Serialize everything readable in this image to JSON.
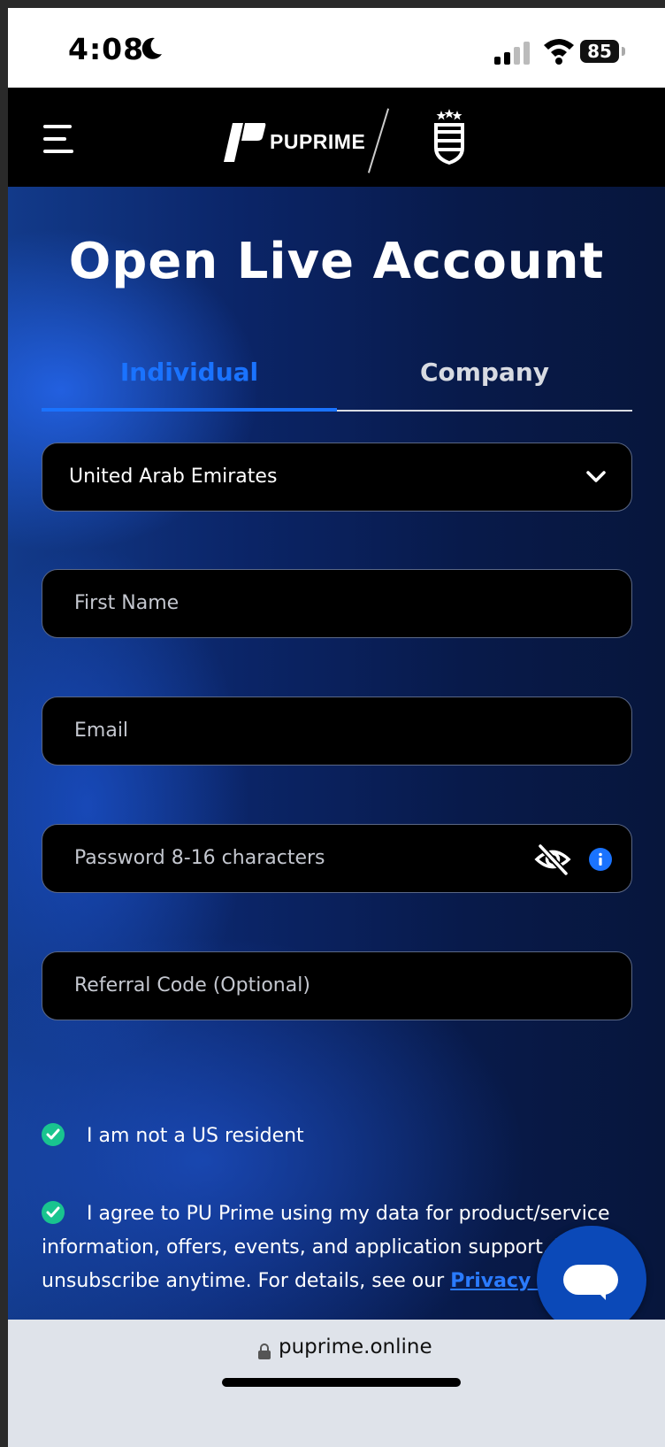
{
  "status_bar": {
    "time": "4:08",
    "battery": "85"
  },
  "header": {
    "brand": "PUPRIME"
  },
  "page": {
    "title": "Open Live Account",
    "tabs": [
      {
        "label": "Individual",
        "active": true
      },
      {
        "label": "Company",
        "active": false
      }
    ]
  },
  "form": {
    "country": "United Arab Emirates",
    "first_name_placeholder": "First Name",
    "email_placeholder": "Email",
    "password_placeholder": "Password 8-16 characters",
    "referral_placeholder": "Referral Code (Optional)"
  },
  "consents": {
    "us_resident": "I am not a US resident",
    "data_line1": "I agree to PU Prime using my data for product/service",
    "data_line2": "information, offers, events, and application support. Yo",
    "data_line3": "unsubscribe anytime. For details, see our ",
    "privacy_link": "Privacy Poli"
  },
  "browser": {
    "url": "puprime.online"
  },
  "colors": {
    "accent": "#1a73ff",
    "check": "#19c48f",
    "chat": "#0b49b8"
  },
  "icons": [
    "moon-icon",
    "signal-icon",
    "wifi-icon",
    "battery-icon",
    "menu-icon",
    "puprime-logo",
    "afa-crest",
    "chevron-down-icon",
    "eye-off-icon",
    "info-icon",
    "check-icon",
    "chat-icon",
    "lock-icon"
  ]
}
